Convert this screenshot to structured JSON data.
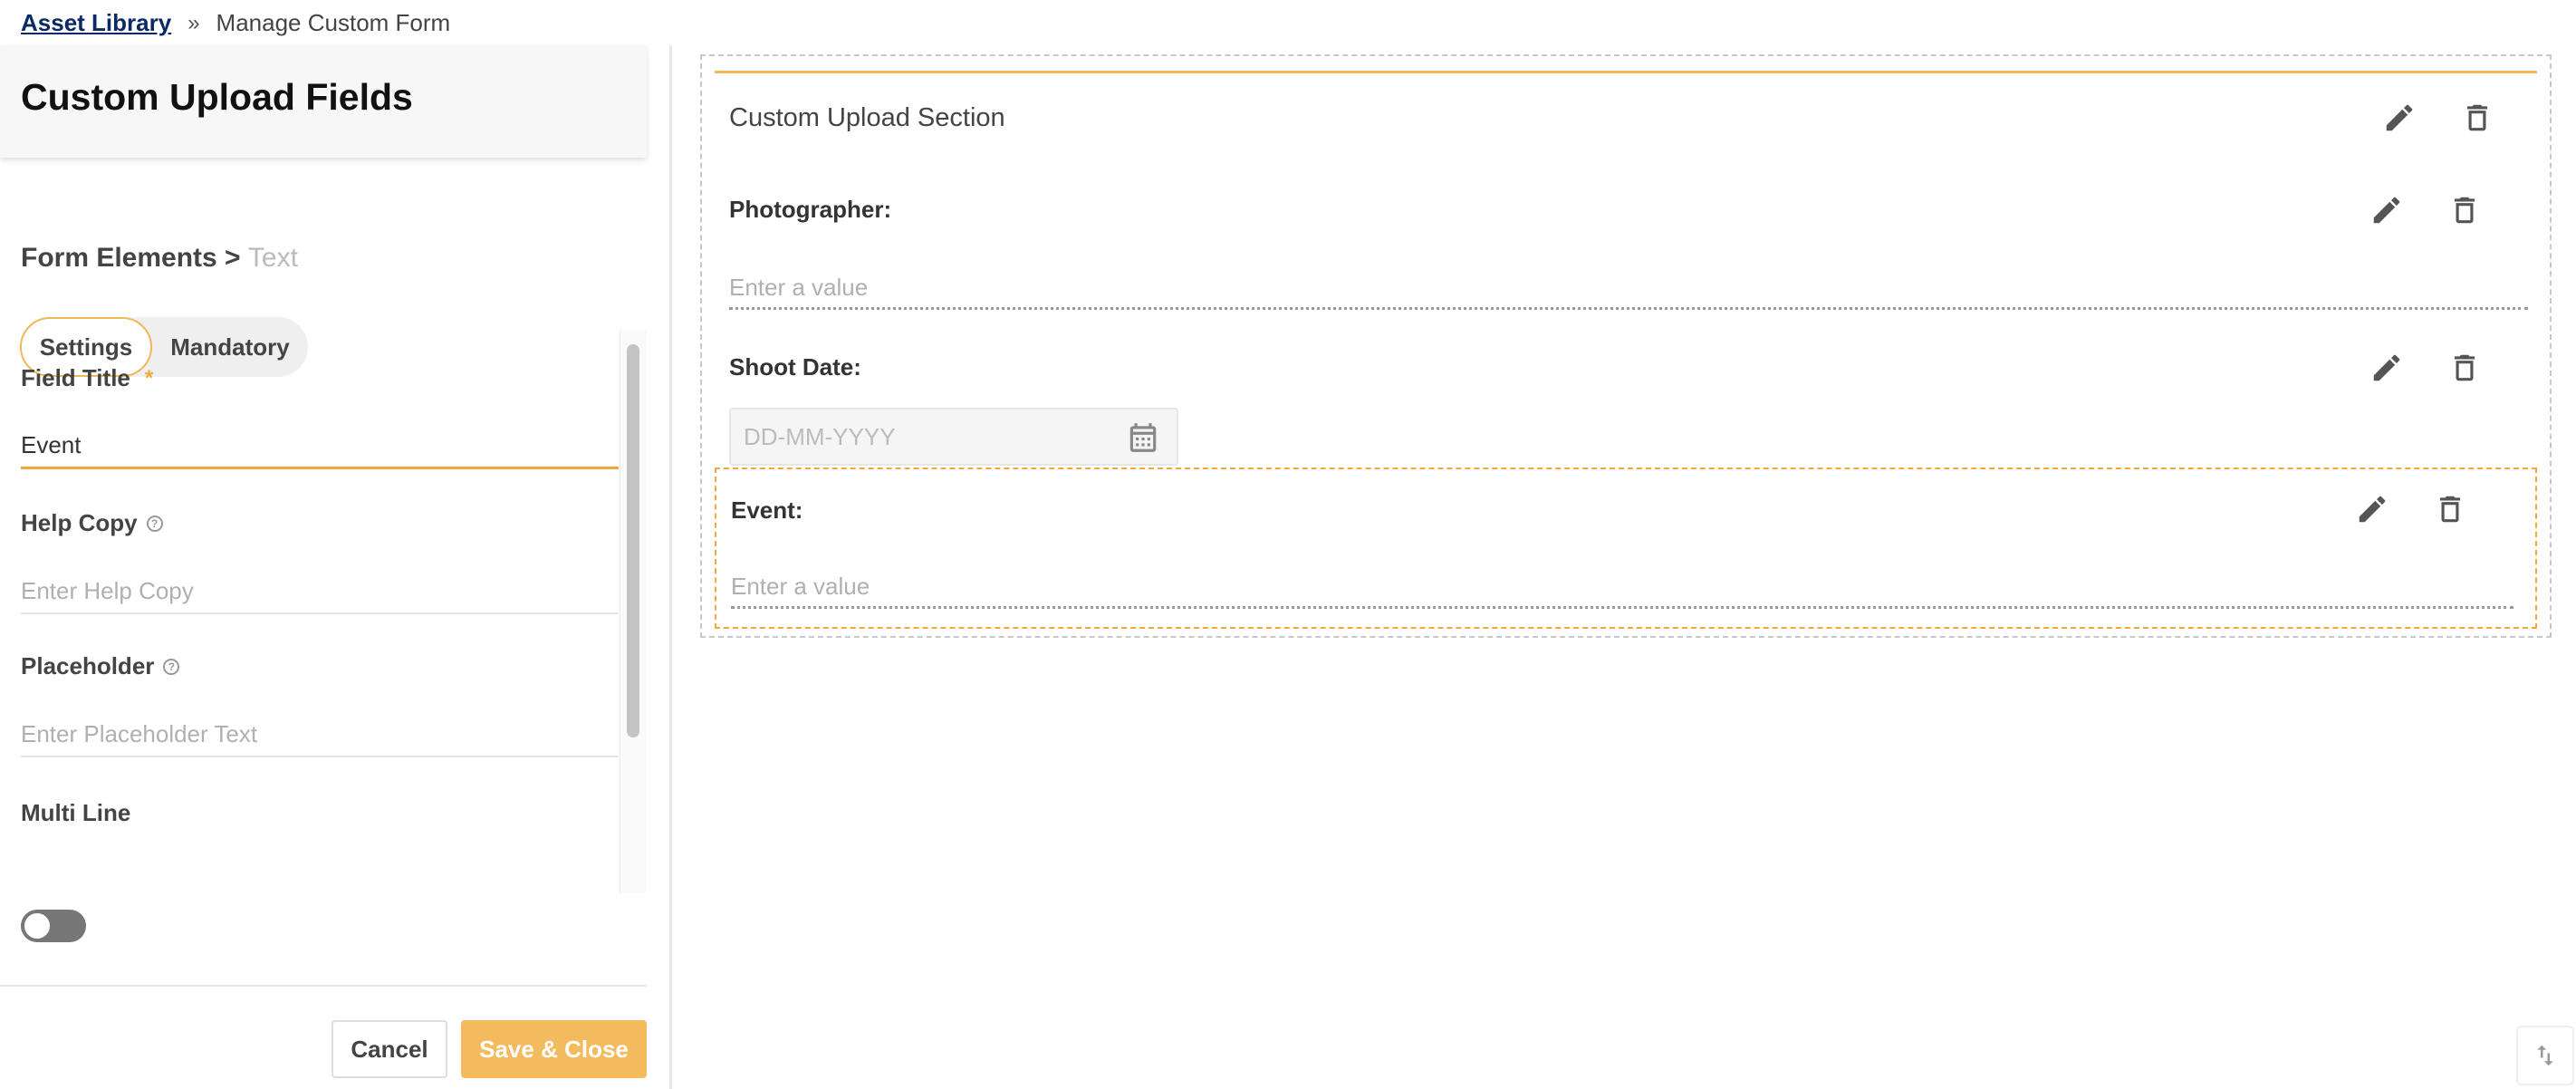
{
  "breadcrumb": {
    "root": "Asset Library",
    "separator": "»",
    "current": "Manage Custom Form"
  },
  "left_panel": {
    "title": "Custom Upload Fields",
    "crumb_prefix": "Form Elements >",
    "crumb_type": "Text",
    "tabs": [
      {
        "label": "Settings",
        "active": true
      },
      {
        "label": "Mandatory",
        "active": false
      }
    ],
    "fields": {
      "field_title": {
        "label": "Field Title",
        "required_mark": "*",
        "value": "Event"
      },
      "help_copy": {
        "label": "Help Copy",
        "placeholder": "Enter Help Copy"
      },
      "placeholder": {
        "label": "Placeholder",
        "placeholder": "Enter Placeholder Text"
      },
      "multi_line": {
        "label": "Multi Line",
        "enabled": false
      }
    },
    "buttons": {
      "cancel": "Cancel",
      "save_close": "Save & Close"
    }
  },
  "canvas": {
    "section_title": "Custom Upload Section",
    "fields": [
      {
        "label": "Photographer:",
        "placeholder": "Enter a value",
        "kind": "text"
      },
      {
        "label": "Shoot Date:",
        "placeholder": "DD-MM-YYYY",
        "kind": "date"
      },
      {
        "label": "Event:",
        "placeholder": "Enter a value",
        "kind": "text",
        "selected": true
      }
    ]
  },
  "icons": {
    "edit": "pencil-icon",
    "delete": "trash-icon",
    "calendar": "calendar-icon",
    "scroll": "sort-arrows-icon"
  },
  "colors": {
    "accent": "#f2a93b",
    "save_button": "#f3bb5e",
    "link": "#0a2a66"
  }
}
